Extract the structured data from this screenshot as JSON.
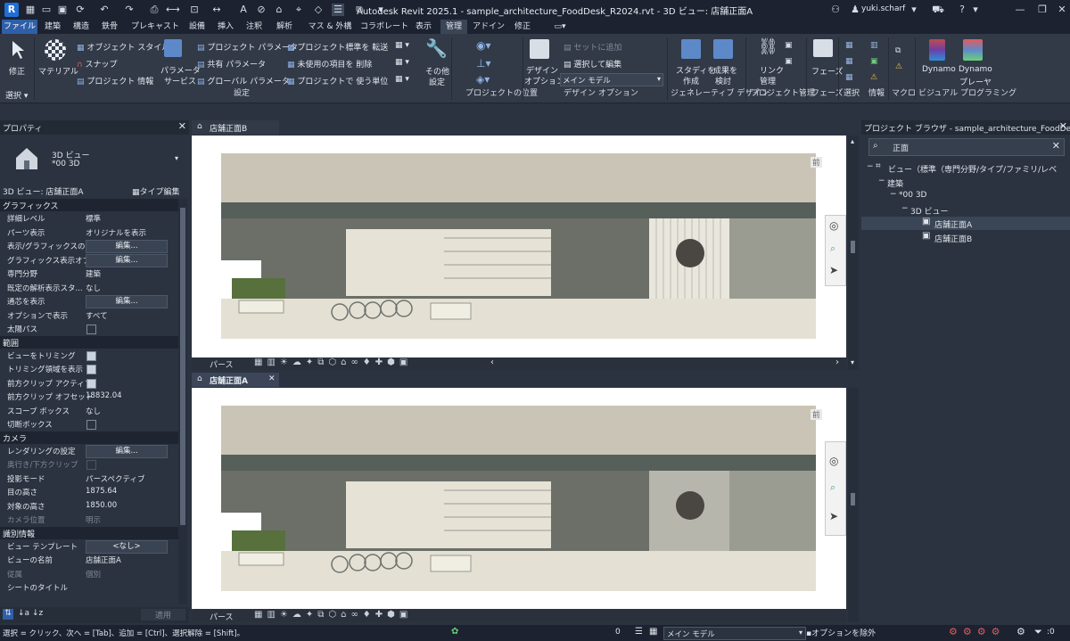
{
  "titlebar": {
    "title": "Autodesk Revit 2025.1 - sample_architecture_FoodDesk_R2024.rvt - 3D ビュー: 店舗正面A",
    "user": "yuki.scharf"
  },
  "menu": [
    "ファイル",
    "建築",
    "構造",
    "鉄骨",
    "プレキャスト",
    "設備",
    "挿入",
    "注釈",
    "解析",
    "マス & 外構",
    "コラボレート",
    "表示",
    "管理",
    "アドイン",
    "修正"
  ],
  "ribbon": {
    "select_label": "選択",
    "modify_label": "修正",
    "material_label": "マテリアル",
    "object_style": "オブジェクト スタイル",
    "snap": "スナップ",
    "project_info": "プロジェクト 情報",
    "param_service_1": "パラメータ",
    "param_service_2": "サービス",
    "project_params": "プロジェクト パラメータ",
    "shared_params": "共有 パラメータ",
    "global_params": "グローバル パラメータ",
    "transfer_std": "プロジェクト標準を 転送",
    "purge": "未使用の項目を 削除",
    "units": "プロジェクトで 使う単位",
    "other_settings_1": "その他",
    "other_settings_2": "設定",
    "settings_group": "設定",
    "project_location_group": "プロジェクトの位置",
    "design_option_1": "デザイン",
    "design_option_2": "オプション",
    "add_to_set": "セットに追加",
    "pick_to_edit": "選択して編集",
    "main_model": "メイン モデル",
    "design_options_group": "デザイン オプション",
    "study_create_1": "スタディを",
    "study_create_2": "作成",
    "explore_1": "成果を",
    "explore_2": "検討",
    "generative_group": "ジェネレーティブ デザイン",
    "link_mgmt_1": "リンク",
    "link_mgmt_2": "管理",
    "project_mgmt_group": "プロジェクト管理",
    "phases_label": "フェーズ",
    "phases_group": "フェーズ",
    "selection_group": "選択",
    "inquiry_group": "情報",
    "macro_group": "マクロ",
    "dynamo": "Dynamo",
    "dynamo_player_1": "Dynamo",
    "dynamo_player_2": "プレーヤ",
    "visual_programming_group": "ビジュアル プログラミング"
  },
  "properties": {
    "panel_title": "プロパティ",
    "type_line1": "3D ビュー",
    "type_line2": "*00 3D",
    "instance_selector": "3D ビュー: 店舗正面A",
    "edit_type": "タイプ編集",
    "apply": "適用",
    "sections": [
      {
        "title": "グラフィックス",
        "rows": [
          {
            "label": "詳細レベル",
            "value": "標準",
            "kind": "text"
          },
          {
            "label": "パーツ表示",
            "value": "オリジナルを表示",
            "kind": "text"
          },
          {
            "label": "表示/グラフィックスの...",
            "value": "編集...",
            "kind": "button"
          },
          {
            "label": "グラフィックス表示オプ...",
            "value": "編集...",
            "kind": "button"
          },
          {
            "label": "専門分野",
            "value": "建築",
            "kind": "text"
          },
          {
            "label": "既定の解析表示スタ...",
            "value": "なし",
            "kind": "text"
          },
          {
            "label": "通芯を表示",
            "value": "編集...",
            "kind": "button"
          },
          {
            "label": "オプションで表示",
            "value": "すべて",
            "kind": "text"
          },
          {
            "label": "太陽パス",
            "value": "",
            "kind": "checkbox",
            "checked": false
          }
        ]
      },
      {
        "title": "範囲",
        "rows": [
          {
            "label": "ビューをトリミング",
            "value": "",
            "kind": "checkbox",
            "checked": true
          },
          {
            "label": "トリミング領域を表示",
            "value": "",
            "kind": "checkbox",
            "checked": true
          },
          {
            "label": "前方クリップ アクティブ",
            "value": "",
            "kind": "checkbox",
            "checked": true
          },
          {
            "label": "前方クリップ オフセット",
            "value": "18832.04",
            "kind": "text"
          },
          {
            "label": "スコープ ボックス",
            "value": "なし",
            "kind": "text"
          },
          {
            "label": "切断ボックス",
            "value": "",
            "kind": "checkbox",
            "checked": false
          }
        ]
      },
      {
        "title": "カメラ",
        "rows": [
          {
            "label": "レンダリングの設定",
            "value": "編集...",
            "kind": "button"
          },
          {
            "label": "奥行き/下方クリップ",
            "value": "",
            "kind": "checkbox-dim",
            "checked": false
          },
          {
            "label": "投影モード",
            "value": "パースペクティブ",
            "kind": "text"
          },
          {
            "label": "目の高さ",
            "value": "1875.64",
            "kind": "text"
          },
          {
            "label": "対象の高さ",
            "value": "1850.00",
            "kind": "text"
          },
          {
            "label": "カメラ位置",
            "value": "明示",
            "kind": "text-dim"
          }
        ]
      },
      {
        "title": "識別情報",
        "rows": [
          {
            "label": "ビュー テンプレート",
            "value": "<なし>",
            "kind": "button"
          },
          {
            "label": "ビューの名前",
            "value": "店舗正面A",
            "kind": "text"
          },
          {
            "label": "従属",
            "value": "個別",
            "kind": "text-dim"
          },
          {
            "label": "シートのタイトル",
            "value": "",
            "kind": "text"
          }
        ]
      }
    ]
  },
  "views": {
    "top_title": "店舗正面B",
    "bottom_title": "店舗正面A",
    "view_label": "前",
    "perspective_label": "パース"
  },
  "browser": {
    "panel_title": "プロジェクト ブラウザ - sample_architecture_FoodDesk...",
    "search_value": "正面",
    "tree": [
      {
        "label": "ビュー（標準（専門分野/タイプ/ファミリ/レベ",
        "depth": 0
      },
      {
        "label": "建築",
        "depth": 1
      },
      {
        "label": "*00 3D",
        "depth": 2
      },
      {
        "label": "3D ビュー",
        "depth": 3
      },
      {
        "label": "店舗正面A",
        "depth": 4,
        "selected": true
      },
      {
        "label": "店舗正面B",
        "depth": 4
      }
    ]
  },
  "status": {
    "hint": "選択 = クリック、次へ = [Tab]、追加 = [Ctrl]、選択解除 = [Shift]。",
    "workset_value": "0",
    "model": "メイン モデル",
    "exclude_options": "オプションを除外",
    "filter_count": ":0"
  },
  "colors": {
    "accent": "#2f5fa8",
    "panel": "#2b3340",
    "ribbon": "#323a48",
    "title": "#1c2230"
  }
}
